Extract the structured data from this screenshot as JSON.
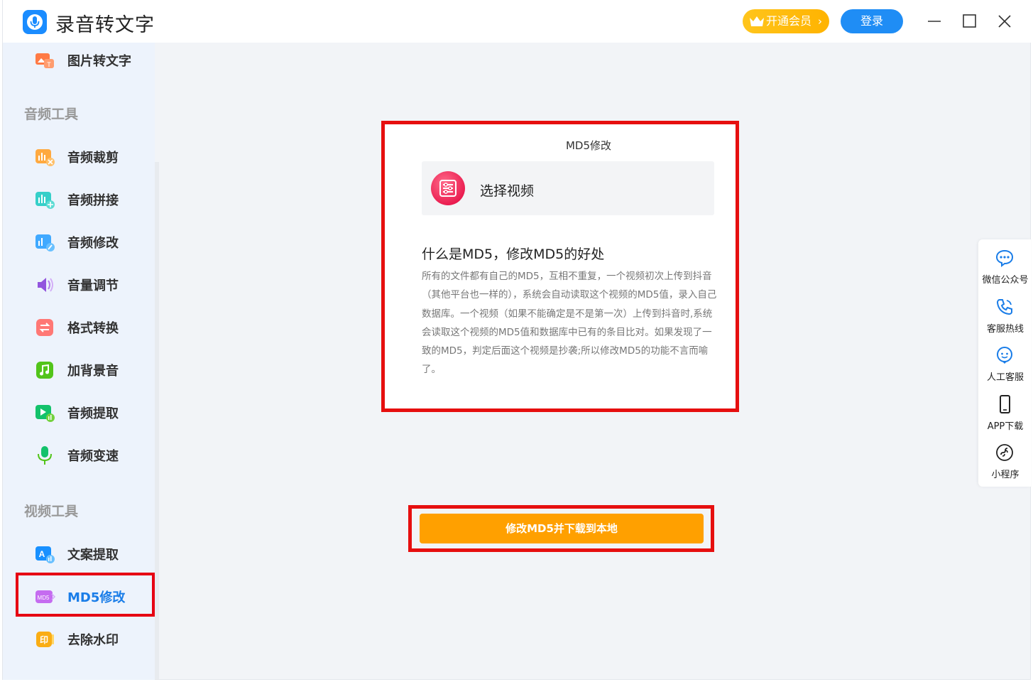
{
  "app": {
    "title": "录音转文字"
  },
  "header": {
    "vip_label": "开通会员",
    "vip_chevron": "›",
    "login_label": "登录"
  },
  "sidebar": {
    "top_item": {
      "label": "图片转文字",
      "icon": "image-to-text-icon"
    },
    "audio_section": "音频工具",
    "audio_items": [
      {
        "label": "音频裁剪",
        "icon": "audio-trim-icon"
      },
      {
        "label": "音频拼接",
        "icon": "audio-join-icon"
      },
      {
        "label": "音频修改",
        "icon": "audio-edit-icon"
      },
      {
        "label": "音量调节",
        "icon": "volume-icon"
      },
      {
        "label": "格式转换",
        "icon": "format-convert-icon"
      },
      {
        "label": "加背景音",
        "icon": "music-note-icon"
      },
      {
        "label": "音频提取",
        "icon": "audio-extract-icon"
      },
      {
        "label": "音频变速",
        "icon": "microphone-icon"
      }
    ],
    "video_section": "视频工具",
    "video_items": [
      {
        "label": "文案提取",
        "icon": "text-extract-icon"
      },
      {
        "label": "MD5修改",
        "icon": "md5-icon",
        "active": true
      },
      {
        "label": "去除水印",
        "icon": "watermark-icon"
      }
    ]
  },
  "main": {
    "panel_title": "MD5修改",
    "select_label": "选择视频",
    "info_title": "什么是MD5，修改MD5的好处",
    "info_text": "所有的文件都有自己的MD5，互相不重复，一个视频初次上传到抖音（其他平台也一样的），系统会自动读取这个视频的MD5值，录入自己数据库。一个视频（如果不能确定是不是第一次）上传到抖音时,系统会读取这个视频的MD5值和数据库中已有的条目比对。如果发现了一致的MD5，判定后面这个视频是抄袭;所以修改MD5的功能不言而喻了。",
    "action_label": "修改MD5并下载到本地"
  },
  "float_panel": {
    "items": [
      {
        "label": "微信公众号",
        "icon": "chat-bubble-icon"
      },
      {
        "label": "客服热线",
        "icon": "phone-icon"
      },
      {
        "label": "人工客服",
        "icon": "support-face-icon"
      },
      {
        "label": "APP下载",
        "icon": "mobile-phone-icon"
      },
      {
        "label": "小程序",
        "icon": "mini-program-icon"
      }
    ]
  },
  "colors": {
    "accent": "#1a7de8",
    "highlight_border": "#e60f0f",
    "action": "#ffa000",
    "vip": "#ffb300"
  }
}
